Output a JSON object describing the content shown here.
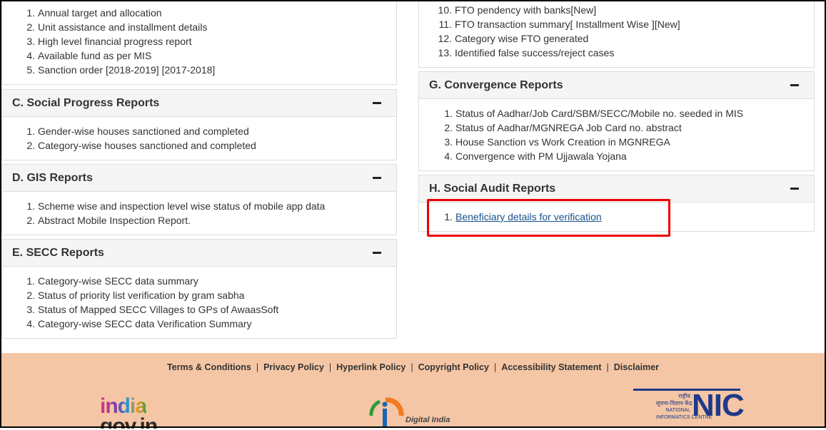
{
  "top_left_list": {
    "items": [
      {
        "num": "2.",
        "text": "Unit assistance and installment details"
      },
      {
        "num": "3.",
        "text": "High level financial progress report"
      },
      {
        "num": "4.",
        "text": "Available fund as per MIS"
      },
      {
        "num": "5.",
        "text": "Sanction order [2018-2019] [2017-2018]"
      }
    ],
    "first": {
      "num": "1.",
      "text": "Annual target and allocation"
    }
  },
  "top_right_list": {
    "items": [
      {
        "num": "10.",
        "text": "FTO pendency with banks[New]"
      },
      {
        "num": "11.",
        "text": "FTO transaction summary[ Installment Wise ][New]"
      },
      {
        "num": "12.",
        "text": "Category wise FTO generated"
      },
      {
        "num": "13.",
        "text": "Identified false success/reject cases"
      }
    ]
  },
  "social_progress": {
    "title": "C. Social Progress Reports",
    "items": [
      {
        "num": "1.",
        "text": "Gender-wise houses sanctioned and completed"
      },
      {
        "num": "2.",
        "text": "Category-wise houses sanctioned and completed"
      }
    ]
  },
  "gis": {
    "title": "D. GIS Reports",
    "items": [
      {
        "num": "1.",
        "text": "Scheme wise and inspection level wise status of mobile app data"
      },
      {
        "num": "2.",
        "text": "Abstract Mobile Inspection Report."
      }
    ]
  },
  "secc": {
    "title": "E. SECC Reports",
    "items": [
      {
        "num": "1.",
        "text": "Category-wise SECC data summary"
      },
      {
        "num": "2.",
        "text": "Status of priority list verification by gram sabha"
      },
      {
        "num": "3.",
        "text": "Status of Mapped SECC Villages to GPs of AwaasSoft"
      },
      {
        "num": "4.",
        "text": "Category-wise SECC data Verification Summary"
      }
    ]
  },
  "convergence": {
    "title": "G. Convergence Reports",
    "items": [
      {
        "num": "1.",
        "text": "Status of Aadhar/Job Card/SBM/SECC/Mobile no. seeded in MIS"
      },
      {
        "num": "2.",
        "text": "Status of Aadhar/MGNREGA Job Card no. abstract"
      },
      {
        "num": "3.",
        "text": "House Sanction vs Work Creation in MGNREGA"
      },
      {
        "num": "4.",
        "text": "Convergence with PM Ujjawala Yojana"
      }
    ]
  },
  "social_audit": {
    "title": "H. Social Audit Reports",
    "items": [
      {
        "num": "1.",
        "text": "Beneficiary details for verification"
      }
    ]
  },
  "footer": {
    "links": [
      "Terms & Conditions",
      "Privacy Policy",
      "Hyperlink Policy",
      "Copyright Policy",
      "Accessibility Statement",
      "Disclaimer"
    ],
    "separator": "|",
    "india_logo": {
      "part1": "india",
      "part2": "gov.in"
    },
    "digital_india": "Digital India",
    "nic": {
      "hindi1": "राष्ट्रीय",
      "hindi2": "सूचना-विज्ञान केंद्र",
      "en1": "NATIONAL",
      "en2": "INFORMATICS CENTRE",
      "mark": "NIC"
    }
  },
  "colors": {
    "footer_bg": "#f5c6a5",
    "highlight": "#e00000",
    "link": "#1a4e8a"
  }
}
